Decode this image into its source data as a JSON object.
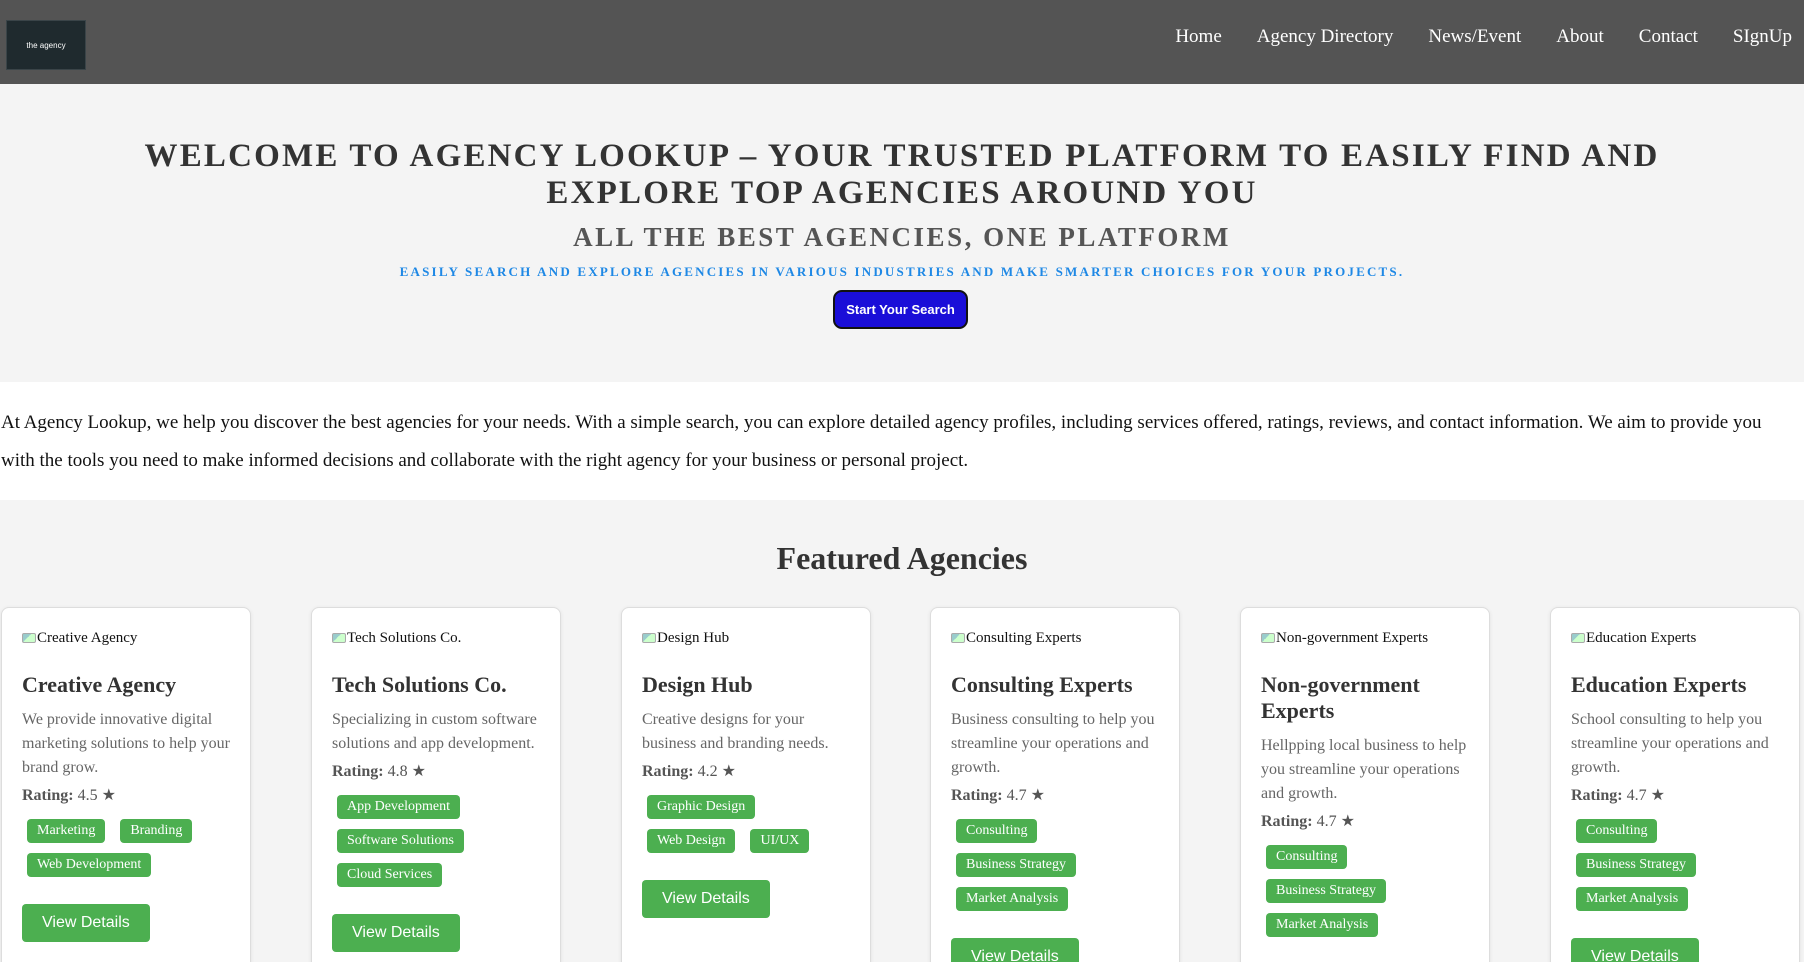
{
  "header": {
    "logo_text": "the agency",
    "nav": [
      "Home",
      "Agency Directory",
      "News/Event",
      "About",
      "Contact",
      "SIgnUp"
    ]
  },
  "hero": {
    "title": "Welcome to Agency Lookup – Your Trusted Platform to Easily Find and Explore Top Agencies Around You",
    "subtitle": "All the Best Agencies, One Platform",
    "tagline": "Easily search and explore agencies in various industries and make smarter choices for your projects.",
    "cta": "Start Your Search"
  },
  "intro": "At Agency Lookup, we help you discover the best agencies for your needs. With a simple search, you can explore detailed agency profiles, including services offered, ratings, reviews, and contact information. We aim to provide you with the tools you need to make informed decisions and collaborate with the right agency for your business or personal project.",
  "featured": {
    "heading": "Featured Agencies",
    "rating_label": "Rating:",
    "button_label": "View Details",
    "cards": [
      {
        "img_alt": "Creative Agency",
        "name": "Creative Agency",
        "desc": "We provide innovative digital marketing solutions to help your brand grow.",
        "rating": "4.5 ★",
        "tags": [
          "Marketing",
          "Branding",
          "Web Development"
        ]
      },
      {
        "img_alt": "Tech Solutions Co.",
        "name": "Tech Solutions Co.",
        "desc": "Specializing in custom software solutions and app development.",
        "rating": "4.8 ★",
        "tags": [
          "App Development",
          "Software Solutions",
          "Cloud Services"
        ]
      },
      {
        "img_alt": "Design Hub",
        "name": "Design Hub",
        "desc": "Creative designs for your business and branding needs.",
        "rating": "4.2 ★",
        "tags": [
          "Graphic Design",
          "Web Design",
          "UI/UX"
        ]
      },
      {
        "img_alt": "Consulting Experts",
        "name": "Consulting Experts",
        "desc": "Business consulting to help you streamline your operations and growth.",
        "rating": "4.7 ★",
        "tags": [
          "Consulting",
          "Business Strategy",
          "Market Analysis"
        ]
      },
      {
        "img_alt": "Non-government Experts",
        "name": "Non-government Experts",
        "desc": "Hellpping local business to help you streamline your operations and growth.",
        "rating": "4.7 ★",
        "tags": [
          "Consulting",
          "Business Strategy",
          "Market Analysis"
        ]
      },
      {
        "img_alt": "Education Experts",
        "name": "Education Experts",
        "desc": "School consulting to help you streamline your operations and growth.",
        "rating": "4.7 ★",
        "tags": [
          "Consulting",
          "Business Strategy",
          "Market Analysis"
        ]
      }
    ]
  }
}
